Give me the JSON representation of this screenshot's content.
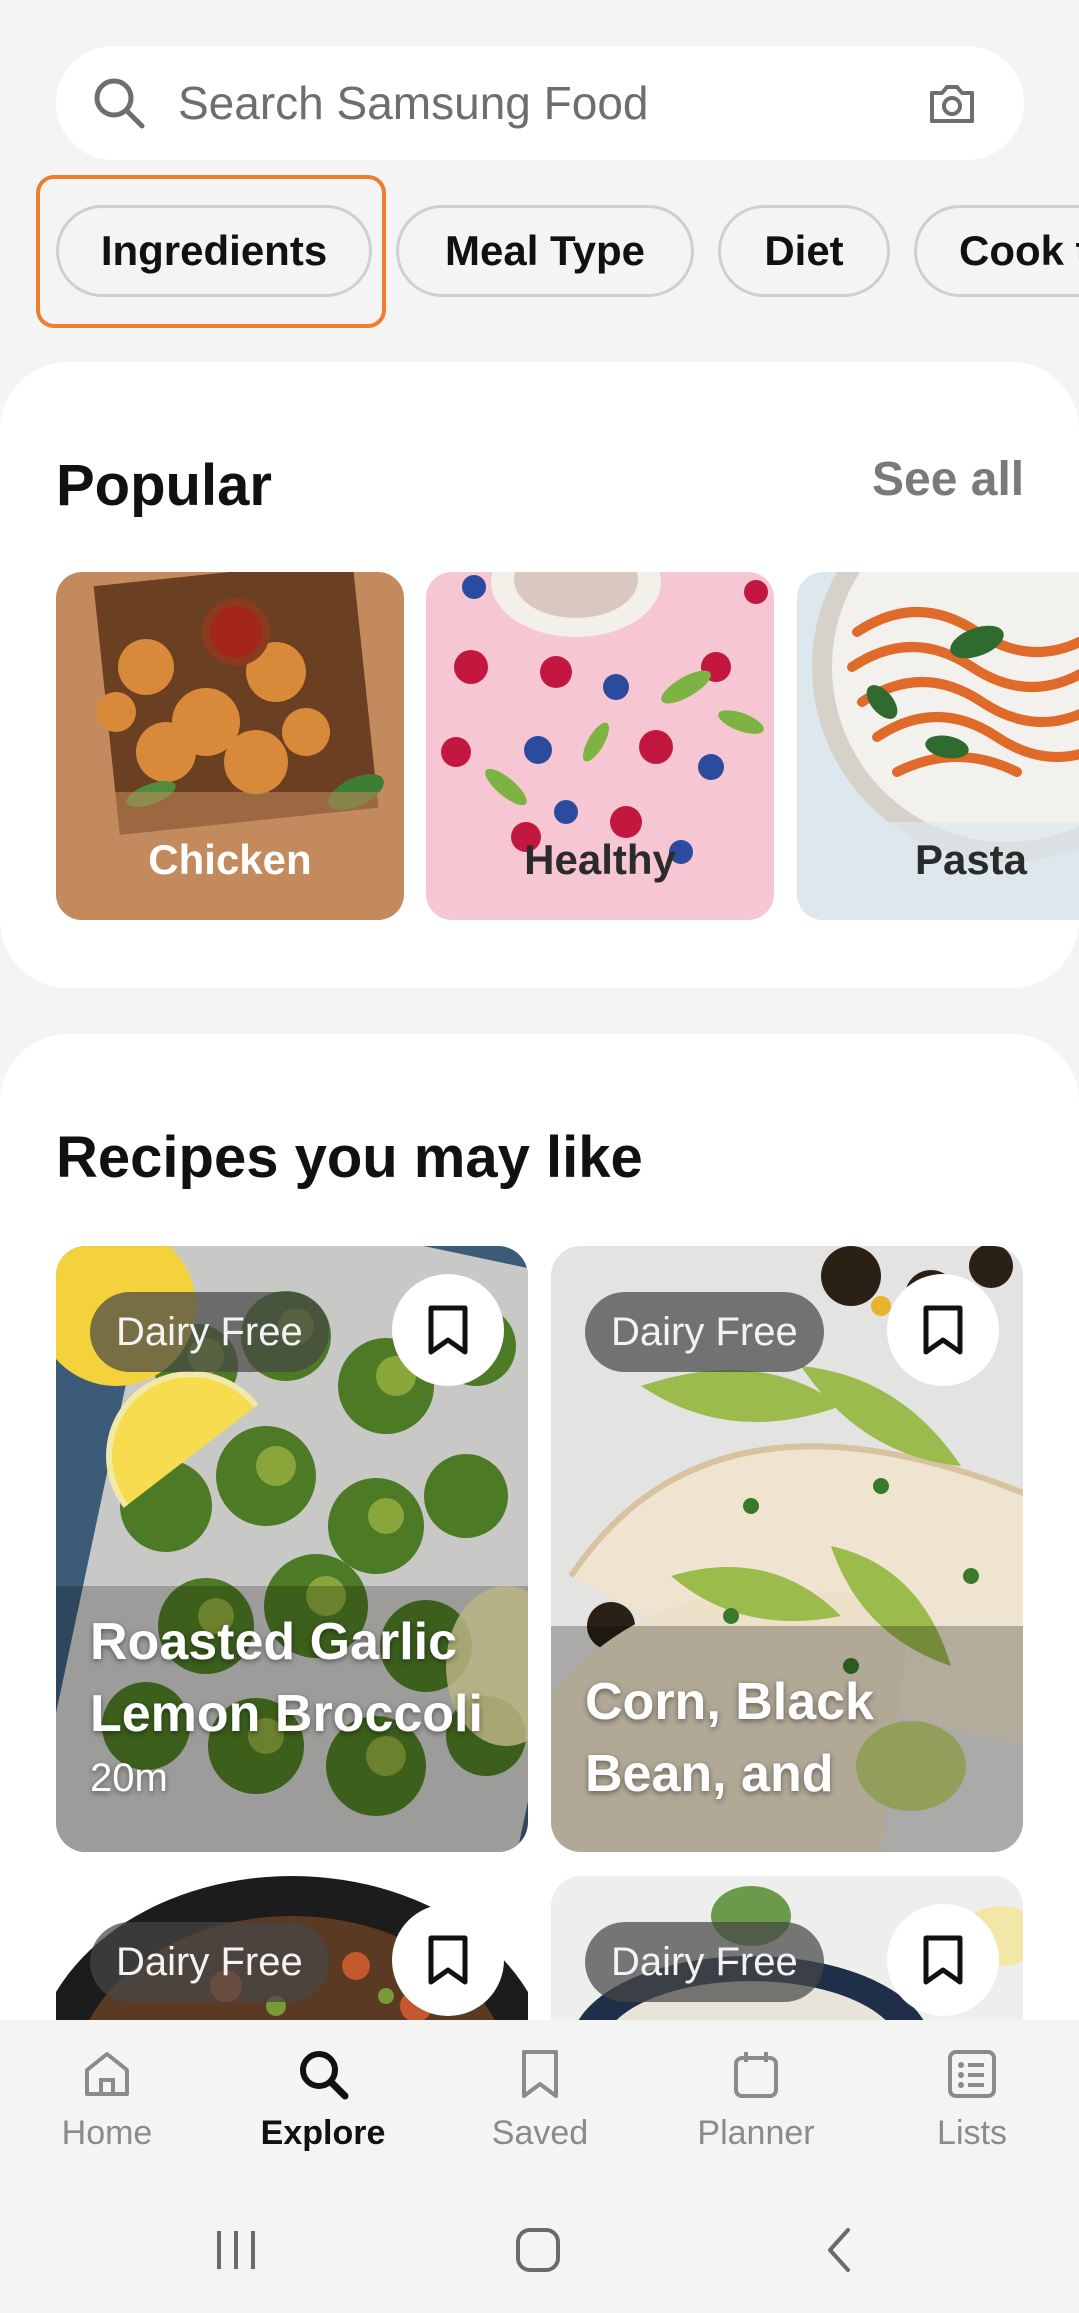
{
  "search": {
    "placeholder": "Search Samsung Food"
  },
  "filters": [
    "Ingredients",
    "Meal Type",
    "Diet",
    "Cook t"
  ],
  "popular": {
    "title": "Popular",
    "see_all": "See all",
    "tiles": [
      {
        "label": "Chicken"
      },
      {
        "label": "Healthy"
      },
      {
        "label": "Pasta"
      }
    ]
  },
  "recipes": {
    "title": "Recipes you may like",
    "items": [
      {
        "badge": "Dairy Free",
        "title_line1": "Roasted Garlic",
        "title_line2": "Lemon Broccoli",
        "time": "20m"
      },
      {
        "badge": "Dairy Free",
        "title_line1": "Corn, Black",
        "title_line2": "Bean, and",
        "time": ""
      },
      {
        "badge": "Dairy Free"
      },
      {
        "badge": "Dairy Free"
      }
    ]
  },
  "nav": [
    {
      "label": "Home",
      "icon": "home-icon"
    },
    {
      "label": "Explore",
      "icon": "search-icon"
    },
    {
      "label": "Saved",
      "icon": "bookmark-icon"
    },
    {
      "label": "Planner",
      "icon": "calendar-icon"
    },
    {
      "label": "Lists",
      "icon": "list-icon"
    }
  ],
  "colors": {
    "accent_focus": "#ef7d2d",
    "background": "#f4f4f5"
  }
}
